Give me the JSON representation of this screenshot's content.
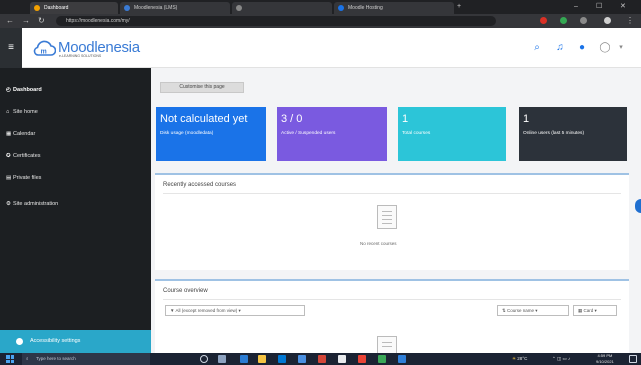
{
  "browser": {
    "tabs": [
      {
        "label": "Dashboard",
        "active": true
      },
      {
        "label": "Moodlenesia (LMS)",
        "active": false
      },
      {
        "label": "",
        "active": false
      },
      {
        "label": "Moodle Hosting",
        "active": false
      }
    ],
    "url": "https://moodlenesia.com/my/",
    "window_controls": {
      "minimize": "–",
      "maximize": "☐",
      "close": "✕"
    }
  },
  "site": {
    "brand_name": "Moodlenesia",
    "brand_tagline": "e-LEARNING SOLUTIONS",
    "brand_color": "#3a7bd5"
  },
  "sidebar": {
    "items": [
      {
        "label": "Dashboard",
        "icon": "dashboard-icon",
        "active": true
      },
      {
        "label": "Site home",
        "icon": "home-icon",
        "active": false
      },
      {
        "label": "Calendar",
        "icon": "calendar-icon",
        "active": false
      },
      {
        "label": "Certificates",
        "icon": "certificate-icon",
        "active": false
      },
      {
        "label": "Private files",
        "icon": "file-icon",
        "active": false
      },
      {
        "label": "Site administration",
        "icon": "gear-icon",
        "active": false
      }
    ],
    "accessibility_label": "Accessibility settings"
  },
  "main": {
    "customise_label": "Customise this page",
    "cards": [
      {
        "big": "Not calculated yet",
        "small": "Disk usage (moodledata)",
        "color": "#1a73e8"
      },
      {
        "big": "3 / 0",
        "small": "Active / Suspended users",
        "color": "#7a5ae0"
      },
      {
        "big": "1",
        "small": "Total courses",
        "color": "#2cc5d8"
      },
      {
        "big": "1",
        "small": "Online users (last 5 minutes)",
        "color": "#2c323a"
      }
    ],
    "recent": {
      "title": "Recently accessed courses",
      "empty": "No recent courses"
    },
    "overview": {
      "title": "Course overview",
      "filter": "All (except removed from view)",
      "sort": "Course name",
      "view": "Card"
    }
  },
  "taskbar": {
    "search_placeholder": "Type here to search",
    "temperature": "28°C",
    "time": "4:59 PM",
    "date": "9/10/2021"
  }
}
